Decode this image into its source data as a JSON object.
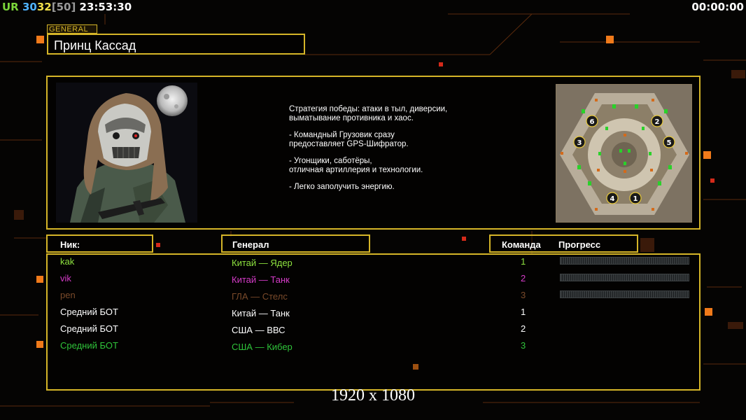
{
  "hud": {
    "ur": "UR",
    "stat_a": "30",
    "stat_b": "32",
    "stat_c": "[50]",
    "clock": "23:53:30",
    "timer": "00:00:00"
  },
  "general_tag": "GENERAL",
  "general_name": "Принц Кассад",
  "description": {
    "line1": "Стратегия победы: атаки в тыл, диверсии,",
    "line2": " выматывание противника и хаос.",
    "line3": "- Командный Грузовик сразу",
    "line4": "предоставляет GPS-Шифратор.",
    "line5": "- Угонщики, саботёры,",
    "line6": "отличная артиллерия и технологии.",
    "line7": "- Легко заполучить энергию."
  },
  "minimap": {
    "slots": [
      "1",
      "2",
      "3",
      "4",
      "5",
      "6"
    ]
  },
  "headers": {
    "nick": "Ник:",
    "general": "Генерал",
    "team": "Команда",
    "progress": "Прогресс"
  },
  "players": [
    {
      "nick": "kak",
      "general": "Китай — Ядер",
      "team": "1",
      "color": "#8ee23f",
      "progress_bar": true
    },
    {
      "nick": "vik",
      "general": "Китай — Танк",
      "team": "2",
      "color": "#d63cc8",
      "progress_bar": true
    },
    {
      "nick": "pen",
      "general": "ГЛА — Стелс",
      "team": "3",
      "color": "#7a4a2a",
      "progress_bar": true
    },
    {
      "nick": "Средний БОТ",
      "general": "Китай — Танк",
      "team": "1",
      "color": "#ffffff",
      "progress_bar": false
    },
    {
      "nick": "Средний БОТ",
      "general": "США — ВВС",
      "team": "2",
      "color": "#ffffff",
      "progress_bar": false
    },
    {
      "nick": "Средний БОТ",
      "general": "США — Кибер",
      "team": "3",
      "color": "#2fc33a",
      "progress_bar": false
    }
  ],
  "resolution": "1920 x 1080",
  "colors": {
    "accent": "#d5b528",
    "orange_square": "#f07a1a",
    "red_square": "#d42a1a"
  }
}
